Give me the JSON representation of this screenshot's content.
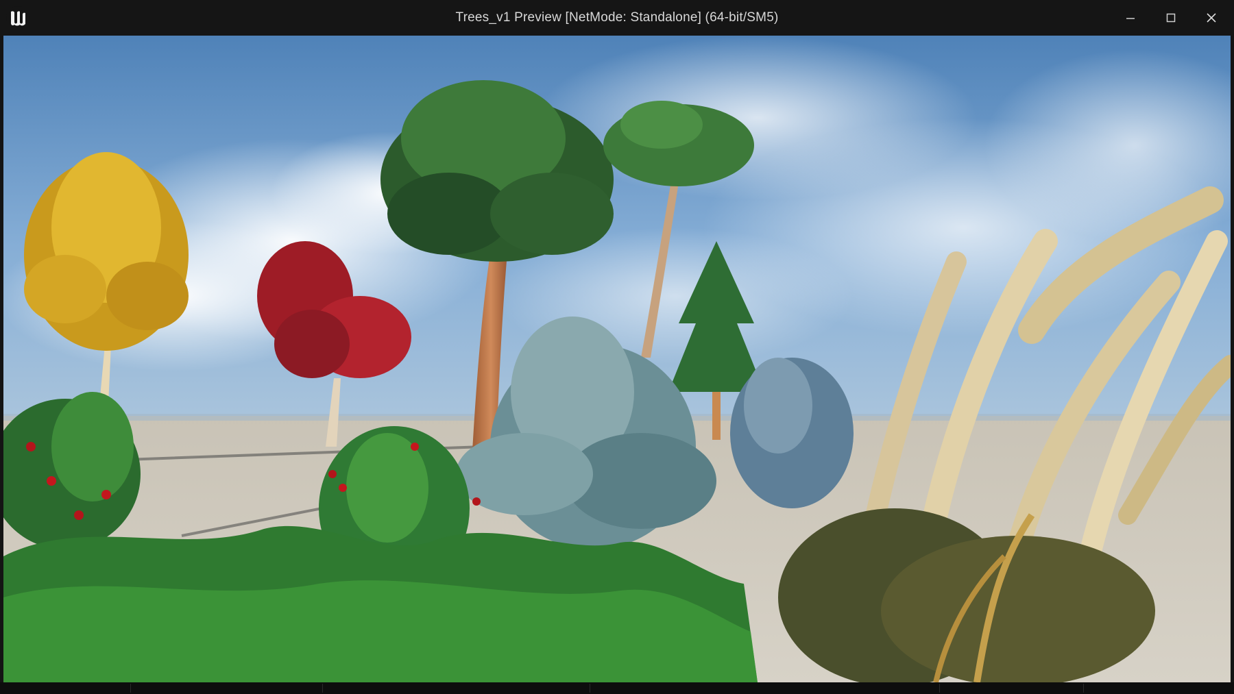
{
  "window": {
    "title": "Trees_v1 Preview [NetMode: Standalone]  (64-bit/SM5)",
    "controls": {
      "minimize": "minimize-icon",
      "maximize": "maximize-icon",
      "close": "close-icon"
    }
  },
  "app_icon": "unreal-engine-logo",
  "colors": {
    "titlebar": "#151515",
    "sky_top": "#4f82b8",
    "ground": "#cdc8bd",
    "title_text": "#d8d8d8"
  }
}
